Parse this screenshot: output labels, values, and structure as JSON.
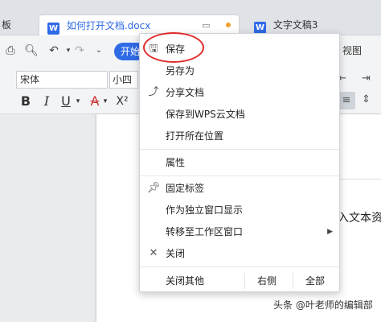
{
  "tabs": {
    "left_partial": "板",
    "active": {
      "icon": "W",
      "title": "如何打开文档.docx"
    },
    "other": {
      "icon": "W",
      "title": "文字文稿3"
    }
  },
  "toolbar": {
    "start_label": "开始",
    "view_label": "视图"
  },
  "ribbon": {
    "font_name": "宋体",
    "font_size": "小四"
  },
  "document": {
    "visible_text": "入文本资"
  },
  "context_menu": {
    "items": [
      {
        "label": "保存",
        "icon": "save-icon"
      },
      {
        "label": "另存为",
        "icon": ""
      },
      {
        "label": "分享文档",
        "icon": "share-icon"
      },
      {
        "label": "保存到WPS云文档",
        "icon": ""
      },
      {
        "label": "打开所在位置",
        "icon": ""
      },
      {
        "label": "属性",
        "icon": ""
      },
      {
        "label": "固定标签",
        "icon": "pin-icon"
      },
      {
        "label": "作为独立窗口显示",
        "icon": ""
      },
      {
        "label": "转移至工作区窗口",
        "icon": ""
      },
      {
        "label": "关闭",
        "icon": "close-icon"
      }
    ],
    "bottom": {
      "close_others": "关闭其他",
      "right_side": "右侧",
      "all": "全部"
    }
  },
  "watermark": "头条 @叶老师的编辑部",
  "colors": {
    "accent": "#2f6be6",
    "highlight_circle": "#e02a2a",
    "unsaved_dot": "#f0a030"
  }
}
